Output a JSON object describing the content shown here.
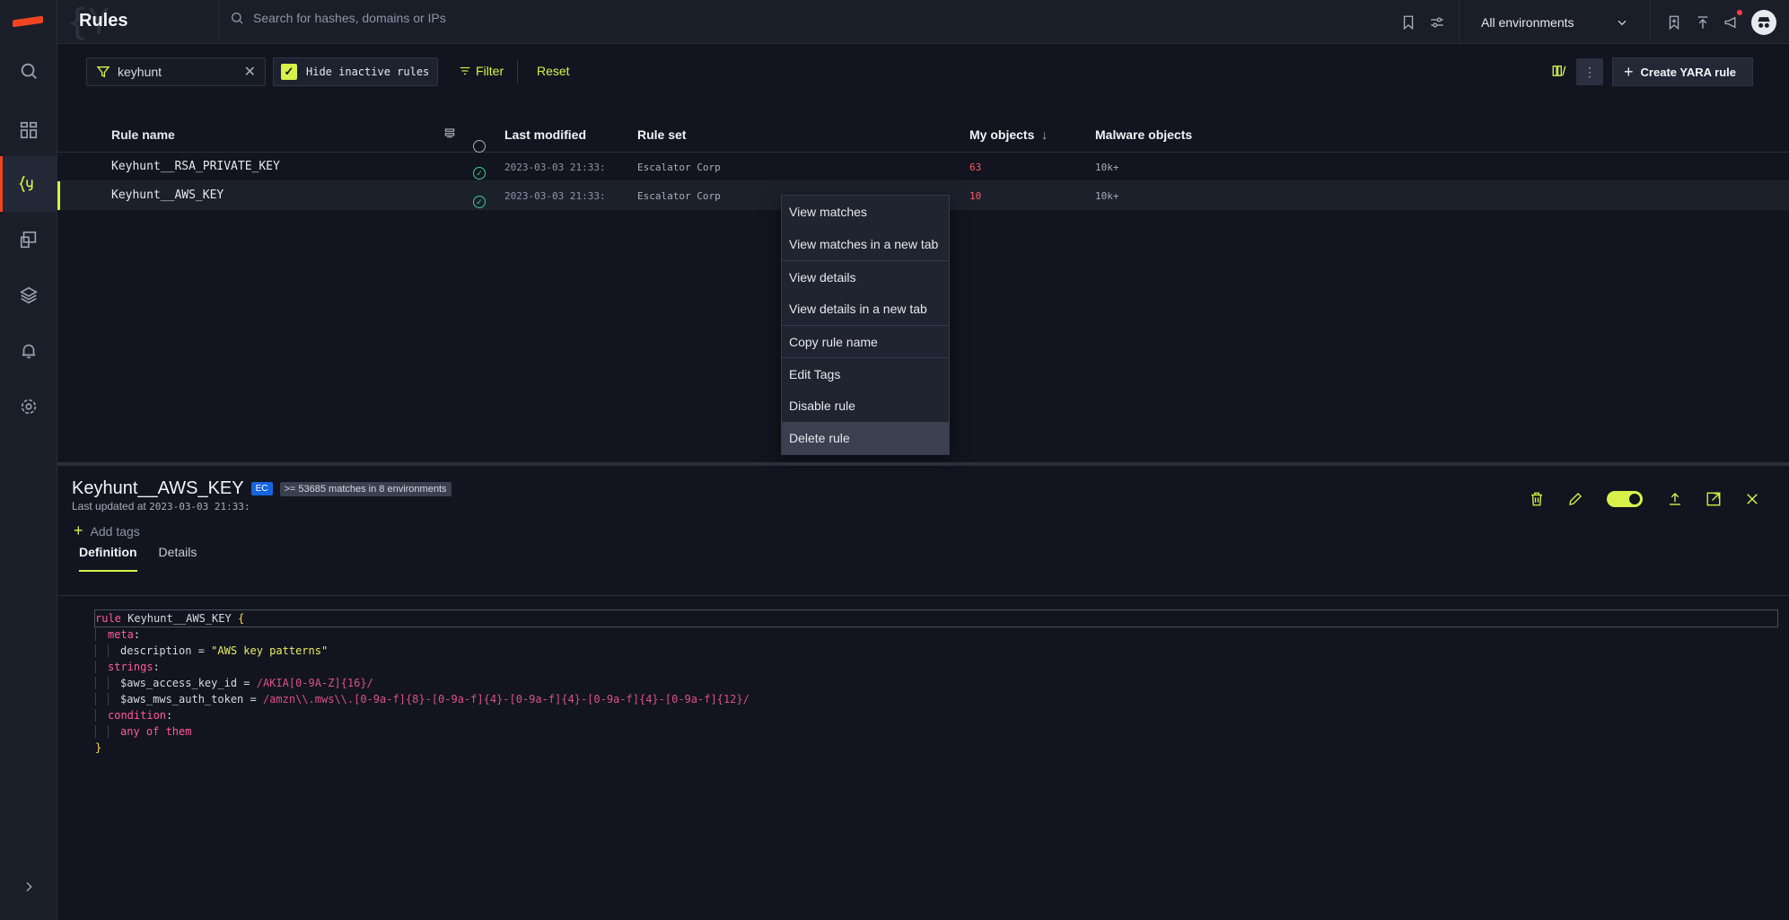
{
  "app": {
    "title": "Rules",
    "search_placeholder": "Search for hashes, domains or IPs",
    "environment": "All environments"
  },
  "toolbar": {
    "filter_value": "keyhunt",
    "hide_inactive_label": "Hide inactive rules",
    "filter_label": "Filter",
    "reset_label": "Reset",
    "create_label": "Create YARA rule"
  },
  "table": {
    "headers": {
      "name": "Rule name",
      "modified": "Last modified",
      "ruleset": "Rule set",
      "my": "My objects",
      "malware": "Malware objects"
    },
    "rows": [
      {
        "name": "Keyhunt__RSA_PRIVATE_KEY",
        "modified": "2023-03-03 21:33:",
        "ruleset": "Escalator Corp",
        "my": "63",
        "malware": "10k+"
      },
      {
        "name": "Keyhunt__AWS_KEY",
        "modified": "2023-03-03 21:33:",
        "ruleset": "Escalator Corp",
        "my": "10",
        "malware": "10k+"
      }
    ]
  },
  "menu": [
    "View matches",
    "View matches in a new tab",
    "View details",
    "View details in a new tab",
    "Copy rule name",
    "Edit Tags",
    "Disable rule",
    "Delete rule"
  ],
  "detail": {
    "name": "Keyhunt__AWS_KEY",
    "badge": "EC",
    "matches": ">= 53685 matches in 8 environments",
    "updated_label": "Last updated at",
    "updated_value": "2023-03-03 21:33:",
    "add_tags": "Add tags",
    "tabs": [
      "Definition",
      "Details"
    ]
  },
  "code": {
    "l1_kw": "rule",
    "l1_name": " Keyhunt__AWS_KEY ",
    "l1_br": "{",
    "meta": "meta",
    "desc_key": "description = ",
    "desc_val": "\"AWS key patterns\"",
    "strings": "strings",
    "s1_key": "$aws_access_key_id = ",
    "s1_val": "/AKIA[0-9A-Z]{16}/",
    "s2_key": "$aws_mws_auth_token = ",
    "s2_val": "/amzn\\\\.mws\\\\.[0-9a-f]{8}-[0-9a-f]{4}-[0-9a-f]{4}-[0-9a-f]{4}-[0-9a-f]{12}/",
    "condition": "condition",
    "cond_val": "any of them",
    "close": "}",
    "colon": ":"
  },
  "colors": {
    "accent": "#d8f24a",
    "brand": "#f0441f",
    "danger": "#ff5a63",
    "success": "#3ecf8e",
    "background": "#12151f"
  },
  "icons": [
    "search-icon",
    "dashboard-icon",
    "yara-rules-icon",
    "reports-icon",
    "layers-icon",
    "bell-icon",
    "gear-icon",
    "bookmark-icon",
    "sliders-icon",
    "bookmark-plus-icon",
    "upload-icon",
    "megaphone-icon",
    "avatar-icon",
    "filter-icon",
    "close-icon",
    "columns-icon",
    "kebab-icon",
    "plus-icon",
    "trash-icon",
    "pencil-icon",
    "export-icon",
    "popout-icon",
    "chevron-right-icon"
  ]
}
